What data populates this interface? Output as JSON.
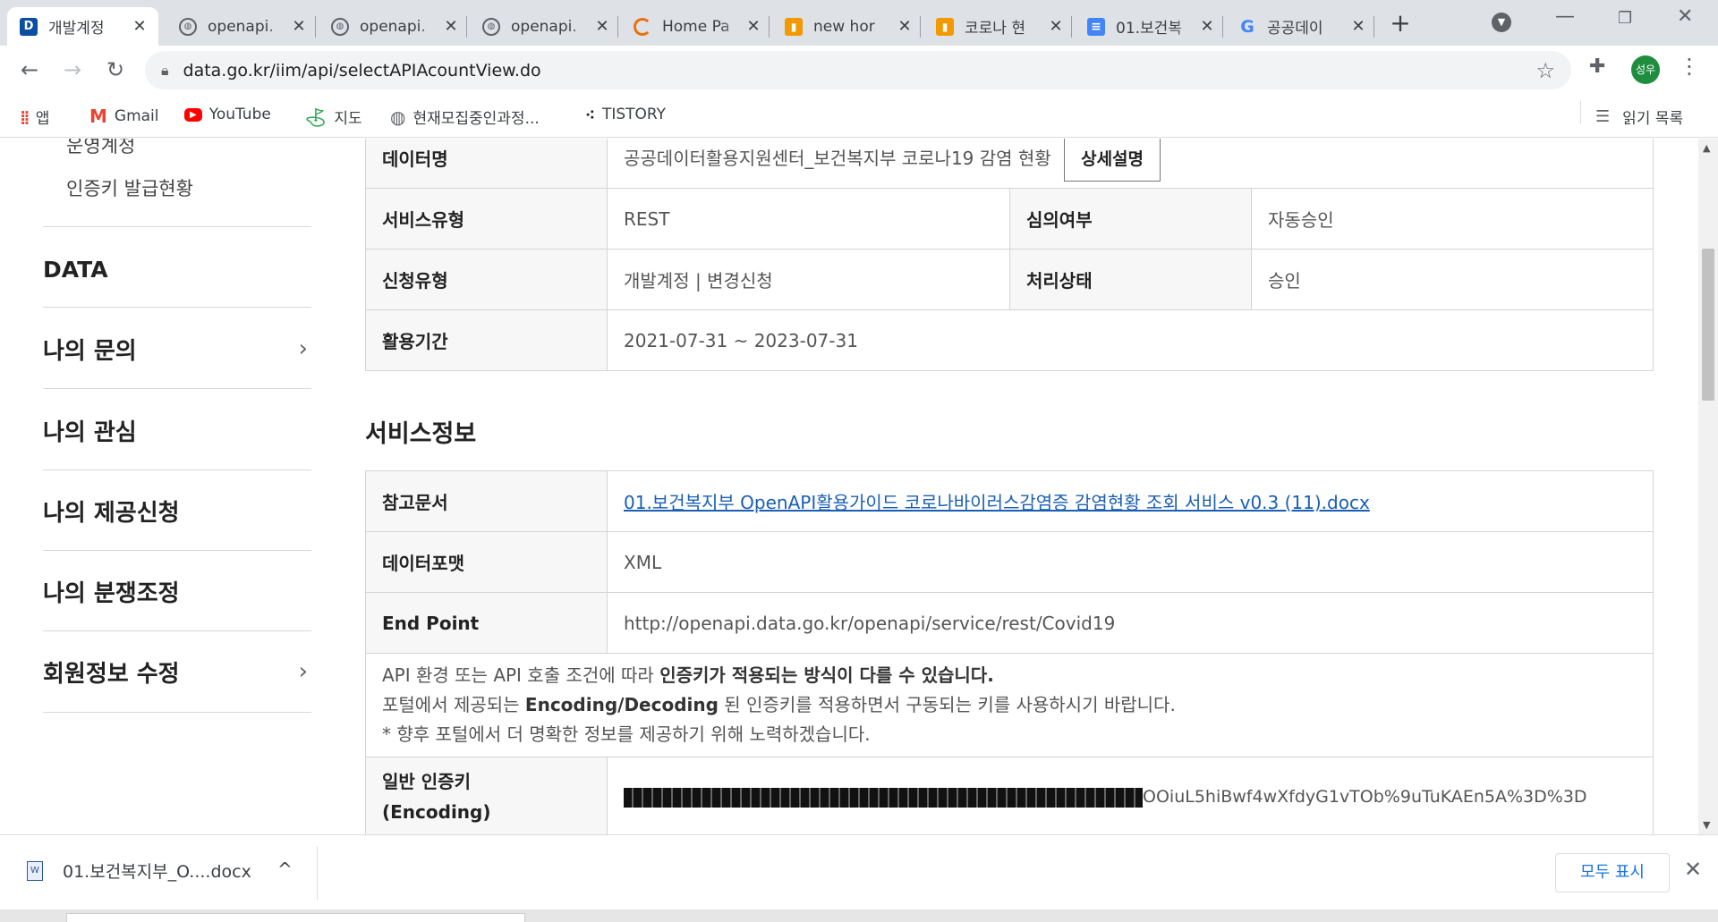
{
  "tabs": [
    {
      "title": "개발계정",
      "favicon": "data-go-kr-icon",
      "active": true
    },
    {
      "title": "openapi.",
      "favicon": "globe-icon"
    },
    {
      "title": "openapi.",
      "favicon": "globe-icon"
    },
    {
      "title": "openapi.",
      "favicon": "globe-icon"
    },
    {
      "title": "Home Pa",
      "favicon": "loading-icon"
    },
    {
      "title": "new hor",
      "favicon": "book-icon"
    },
    {
      "title": "코로나 현",
      "favicon": "book-icon"
    },
    {
      "title": "01.보건복",
      "favicon": "docs-icon"
    },
    {
      "title": "공공데이",
      "favicon": "google-icon"
    }
  ],
  "address_bar": {
    "url": "data.go.kr/iim/api/selectAPIAcountView.do"
  },
  "profile": {
    "initials": "성우"
  },
  "bookmarks": [
    {
      "label": "앱",
      "icon": "apps-grid-icon"
    },
    {
      "label": "Gmail",
      "icon": "gmail-icon"
    },
    {
      "label": "YouTube",
      "icon": "youtube-icon"
    },
    {
      "label": "지도",
      "icon": "maps-icon"
    },
    {
      "label": "현재모집중인과정...",
      "icon": "globe-icon"
    },
    {
      "label": "TISTORY",
      "icon": "tistory-icon"
    }
  ],
  "reading_list": {
    "label": "읽기 목록"
  },
  "sidebar": {
    "subitems": [
      "운영계정",
      "인증키 발급현황"
    ],
    "items": [
      {
        "label": "DATA",
        "chevron": false
      },
      {
        "label": "나의 문의",
        "chevron": true
      },
      {
        "label": "나의 관심",
        "chevron": false
      },
      {
        "label": "나의 제공신청",
        "chevron": false
      },
      {
        "label": "나의 분쟁조정",
        "chevron": false
      },
      {
        "label": "회원정보 수정",
        "chevron": true
      }
    ]
  },
  "application_info": {
    "data_name_label": "데이터명",
    "data_name": "공공데이터활용지원센터_보건복지부 코로나19 감염 현황",
    "detail_button": "상세설명",
    "service_type_label": "서비스유형",
    "service_type": "REST",
    "review_label": "심의여부",
    "review": "자동승인",
    "request_type_label": "신청유형",
    "request_type": "개발계정 | 변경신청",
    "status_label": "처리상태",
    "status": "승인",
    "period_label": "활용기간",
    "period": "2021-07-31 ~ 2023-07-31"
  },
  "service_info": {
    "section_title": "서비스정보",
    "ref_doc_label": "참고문서",
    "ref_doc": "01.보건복지부 OpenAPI활용가이드 코로나바이러스감염증 감염현황 조회 서비스 v0.3 (11).docx",
    "format_label": "데이터포맷",
    "format": "XML",
    "endpoint_label": "End Point",
    "endpoint": "http://openapi.data.go.kr/openapi/service/rest/Covid19",
    "notice_line1_pre": "API 환경 또는 API 호출 조건에 따라 ",
    "notice_line1_bold": "인증키가 적용되는 방식이 다를 수 있습니다.",
    "notice_line2_pre": "포털에서 제공되는 ",
    "notice_line2_bold": "Encoding/Decoding",
    "notice_line2_post": " 된 인증키를 적용하면서 구동되는 키를 사용하시기 바랍니다.",
    "notice_line3": "* 향후 포털에서 더 명확한 정보를 제공하기 위해 노력하겠습니다.",
    "key_label_line1": "일반 인증키",
    "key_label_line2": "(Encoding)",
    "key_visible_tail": "OOiuL5hiBwf4wXfdyG1vTOb%9uTuKAEn5A%3D%3D"
  },
  "download_shelf": {
    "filename": "01.보건복지부_O....docx",
    "show_all": "모두 표시"
  }
}
